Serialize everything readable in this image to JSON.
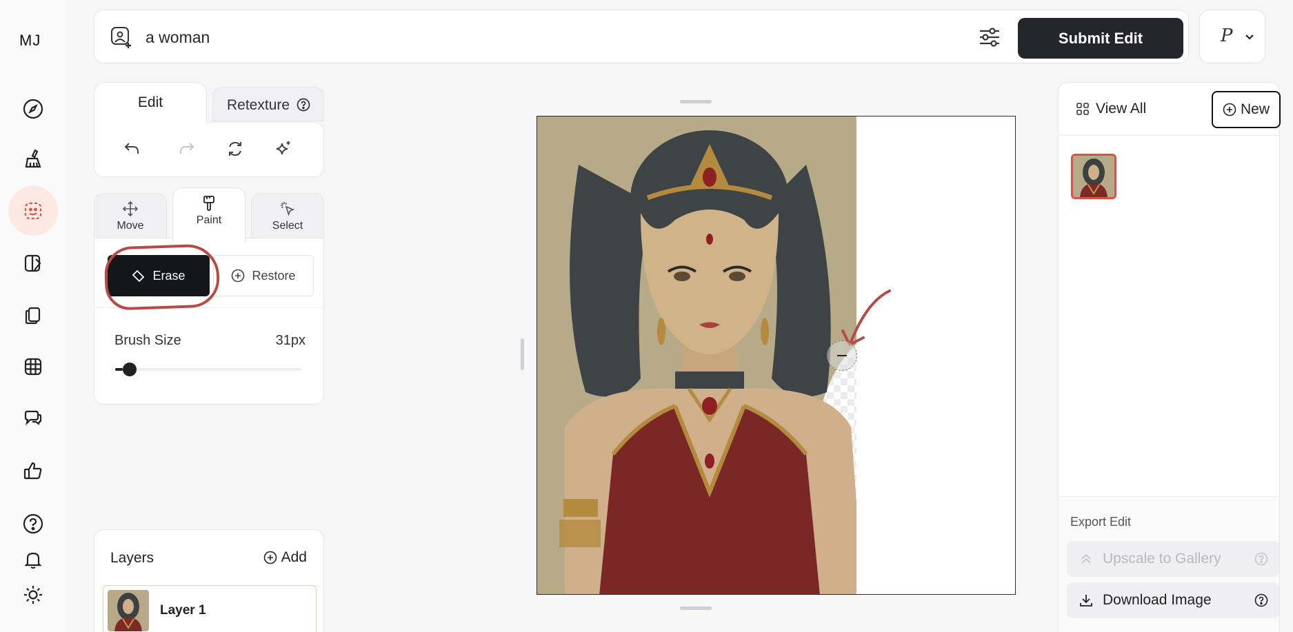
{
  "app": {
    "logo": "MJ"
  },
  "rail": [
    {
      "icon": "compass-icon"
    },
    {
      "icon": "brush-icon"
    },
    {
      "icon": "edit-icon",
      "active": true
    },
    {
      "icon": "paint-palette-icon"
    },
    {
      "icon": "copy-icon"
    },
    {
      "icon": "grid-icon"
    },
    {
      "icon": "chat-icon"
    },
    {
      "icon": "thumbs-up-icon"
    },
    {
      "icon": "help-icon"
    },
    {
      "icon": "bell-icon"
    },
    {
      "icon": "sun-icon"
    }
  ],
  "prompt": {
    "text": "a woman"
  },
  "toolbar": {
    "submit_label": "Submit Edit",
    "profile_initial": "P"
  },
  "edit_panel": {
    "tabs": [
      "Edit",
      "Retexture"
    ],
    "active_tab": "Edit",
    "tools": [
      "undo-icon",
      "redo-icon",
      "reset-icon",
      "sparkle-icon"
    ]
  },
  "mode_tabs": [
    {
      "label": "Move",
      "icon": "move-icon"
    },
    {
      "label": "Paint",
      "icon": "paint-icon",
      "active": true
    },
    {
      "label": "Select",
      "icon": "select-icon"
    }
  ],
  "paint": {
    "erase_label": "Erase",
    "restore_label": "Restore",
    "selected": "Erase",
    "brush_label": "Brush Size",
    "brush_value": "31px",
    "brush_fraction": 0.04
  },
  "layers": {
    "title": "Layers",
    "add_label": "Add",
    "items": [
      {
        "name": "Layer 1"
      }
    ]
  },
  "right_panel": {
    "view_all_label": "View All",
    "new_label": "New",
    "export_title": "Export Edit",
    "upscale_label": "Upscale to Gallery",
    "download_label": "Download Image"
  },
  "colors": {
    "accent": "#d9534a",
    "dark_button": "#25262c",
    "annotation": "#b64a44"
  }
}
